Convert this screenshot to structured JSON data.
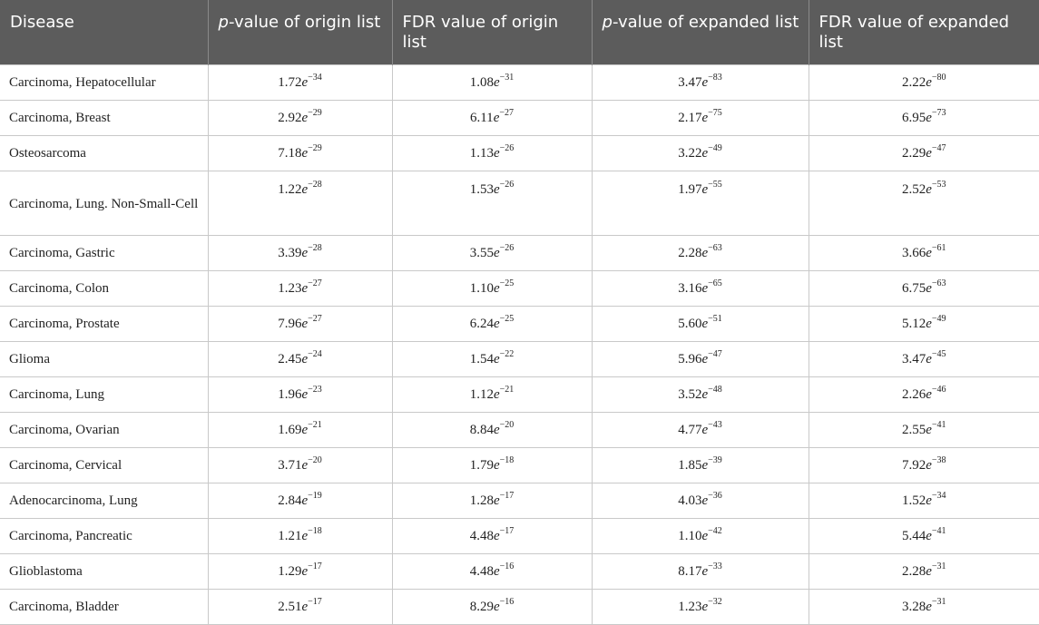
{
  "headers": [
    {
      "pre": "Disease",
      "em": "",
      "post": ""
    },
    {
      "pre": "",
      "em": "p",
      "post": "-value of origin list"
    },
    {
      "pre": "FDR value of origin list",
      "em": "",
      "post": ""
    },
    {
      "pre": "",
      "em": "p",
      "post": "-value of expanded list"
    },
    {
      "pre": "FDR value of expanded list",
      "em": "",
      "post": ""
    }
  ],
  "rows": [
    {
      "disease": "Carcinoma, Hepatocellular",
      "vals": [
        [
          "1.72",
          "−34"
        ],
        [
          "1.08",
          "−31"
        ],
        [
          "3.47",
          "−83"
        ],
        [
          "2.22",
          "−80"
        ]
      ]
    },
    {
      "disease": "Carcinoma, Breast",
      "vals": [
        [
          "2.92",
          "−29"
        ],
        [
          "6.11",
          "−27"
        ],
        [
          "2.17",
          "−75"
        ],
        [
          "6.95",
          "−73"
        ]
      ]
    },
    {
      "disease": "Osteosarcoma",
      "vals": [
        [
          "7.18",
          "−29"
        ],
        [
          "1.13",
          "−26"
        ],
        [
          "3.22",
          "−49"
        ],
        [
          "2.29",
          "−47"
        ]
      ]
    },
    {
      "disease": "Carcinoma, Lung. Non-Small-Cell",
      "vals": [
        [
          "1.22",
          "−28"
        ],
        [
          "1.53",
          "−26"
        ],
        [
          "1.97",
          "−55"
        ],
        [
          "2.52",
          "−53"
        ]
      ]
    },
    {
      "disease": "Carcinoma, Gastric",
      "vals": [
        [
          "3.39",
          "−28"
        ],
        [
          "3.55",
          "−26"
        ],
        [
          "2.28",
          "−63"
        ],
        [
          "3.66",
          "−61"
        ]
      ]
    },
    {
      "disease": "Carcinoma, Colon",
      "vals": [
        [
          "1.23",
          "−27"
        ],
        [
          "1.10",
          "−25"
        ],
        [
          "3.16",
          "−65"
        ],
        [
          "6.75",
          "−63"
        ]
      ]
    },
    {
      "disease": "Carcinoma, Prostate",
      "vals": [
        [
          "7.96",
          "−27"
        ],
        [
          "6.24",
          "−25"
        ],
        [
          "5.60",
          "−51"
        ],
        [
          "5.12",
          "−49"
        ]
      ]
    },
    {
      "disease": "Glioma",
      "vals": [
        [
          "2.45",
          "−24"
        ],
        [
          "1.54",
          "−22"
        ],
        [
          "5.96",
          "−47"
        ],
        [
          "3.47",
          "−45"
        ]
      ]
    },
    {
      "disease": "Carcinoma, Lung",
      "vals": [
        [
          "1.96",
          "−23"
        ],
        [
          "1.12",
          "−21"
        ],
        [
          "3.52",
          "−48"
        ],
        [
          "2.26",
          "−46"
        ]
      ]
    },
    {
      "disease": "Carcinoma, Ovarian",
      "vals": [
        [
          "1.69",
          "−21"
        ],
        [
          "8.84",
          "−20"
        ],
        [
          "4.77",
          "−43"
        ],
        [
          "2.55",
          "−41"
        ]
      ]
    },
    {
      "disease": "Carcinoma, Cervical",
      "vals": [
        [
          "3.71",
          "−20"
        ],
        [
          "1.79",
          "−18"
        ],
        [
          "1.85",
          "−39"
        ],
        [
          "7.92",
          "−38"
        ]
      ]
    },
    {
      "disease": "Adenocarcinoma, Lung",
      "vals": [
        [
          "2.84",
          "−19"
        ],
        [
          "1.28",
          "−17"
        ],
        [
          "4.03",
          "−36"
        ],
        [
          "1.52",
          "−34"
        ]
      ]
    },
    {
      "disease": "Carcinoma, Pancreatic",
      "vals": [
        [
          "1.21",
          "−18"
        ],
        [
          "4.48",
          "−17"
        ],
        [
          "1.10",
          "−42"
        ],
        [
          "5.44",
          "−41"
        ]
      ]
    },
    {
      "disease": "Glioblastoma",
      "vals": [
        [
          "1.29",
          "−17"
        ],
        [
          "4.48",
          "−16"
        ],
        [
          "8.17",
          "−33"
        ],
        [
          "2.28",
          "−31"
        ]
      ]
    },
    {
      "disease": "Carcinoma, Bladder",
      "vals": [
        [
          "2.51",
          "−17"
        ],
        [
          "8.29",
          "−16"
        ],
        [
          "1.23",
          "−32"
        ],
        [
          "3.28",
          "−31"
        ]
      ]
    }
  ],
  "exp_base": "e"
}
